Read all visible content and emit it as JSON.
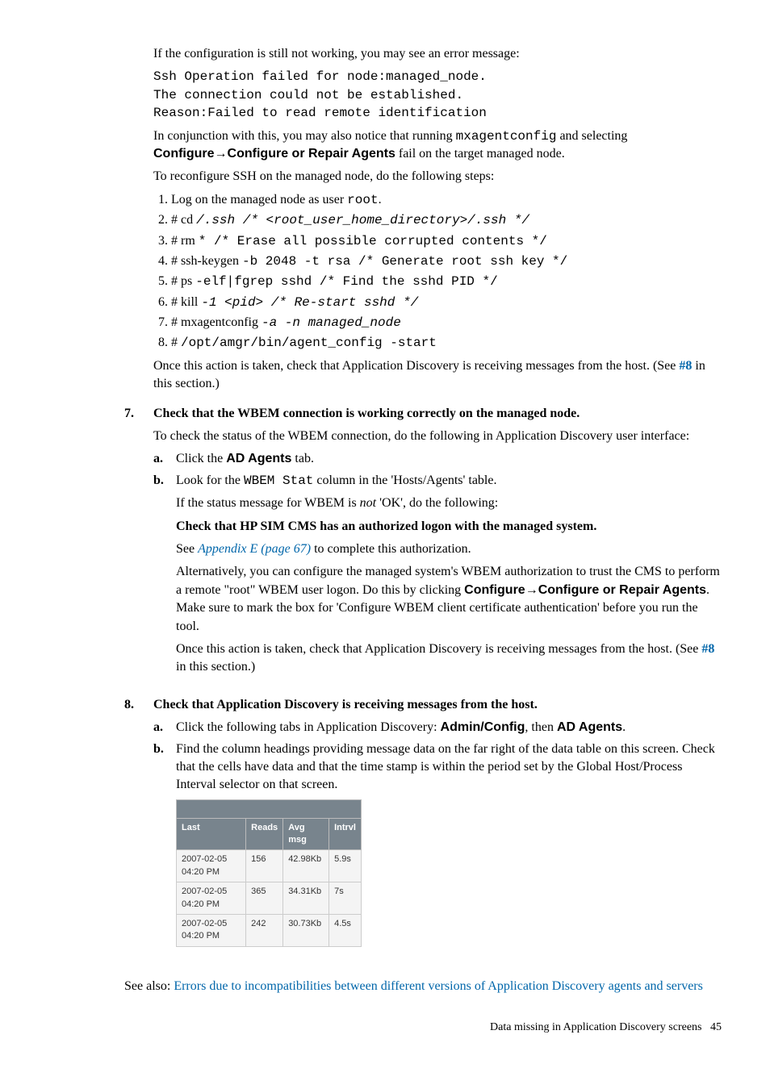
{
  "p1": "If the configuration is still not working, you may see an error message:",
  "err1": "Ssh Operation failed for node:managed_node.",
  "err2": "The connection could not be established.",
  "err3": "Reason:Failed to read remote identification",
  "p2a": "In conjunction with this, you may also notice that running ",
  "p2_code": "mxagentconfig",
  "p2b": " and selecting ",
  "p2_conf": "Configure",
  "arrow": "→",
  "p2_repair": "Configure or Repair Agents",
  "p2c": " fail on the target managed node.",
  "p3": "To reconfigure SSH on the managed node, do the following steps:",
  "li1a": "Log on the managed node as user ",
  "li1_code": "root",
  "li1b": ".",
  "li2a": "# cd ",
  "li2_code": "/.ssh /* <root_user_home_directory>/.ssh */",
  "li3a": "# rm ",
  "li3_code": "* /* Erase all possible corrupted contents */",
  "li4a": "# ssh-keygen ",
  "li4_code": "-b 2048 -t rsa /* Generate root ssh key */",
  "li5a": "# ps ",
  "li5_code": "-elf|fgrep sshd /* Find the sshd PID */",
  "li6a": "# kill ",
  "li6_code": "-1 <pid> /* Re-start sshd */",
  "li7a": "# mxagentconfig ",
  "li7_code": "-a -n managed_node",
  "li8a": "# ",
  "li8_code": "/opt/amgr/bin/agent_config -start",
  "p4a": "Once this action is taken, check that Application Discovery is receiving messages from the host. (See ",
  "p4_link": "#8",
  "p4b": " in this section.)",
  "step7_num": "7.",
  "step7_title": "Check that the WBEM connection is working correctly on the managed node.",
  "step7_p1": "To check the status of the WBEM connection, do the following in Application Discovery user interface:",
  "s7a_letter": "a.",
  "s7a_1": "Click the ",
  "s7a_bold": "AD Agents",
  "s7a_2": " tab.",
  "s7b_letter": "b.",
  "s7b_1": "Look for the ",
  "s7b_code": "WBEM Stat",
  "s7b_2": " column in the 'Hosts/Agents' table.",
  "s7b_p2a": "If the status message for WBEM is ",
  "s7b_not": "not",
  "s7b_p2b": " 'OK', do the following:",
  "s7b_bold_line": "Check that HP SIM CMS has an authorized logon with the managed system.",
  "s7b_see": "See ",
  "s7b_link": "Appendix E (page 67)",
  "s7b_see2": " to complete this authorization.",
  "s7b_alt1": "Alternatively, you can configure the managed system's WBEM authorization to trust the CMS to perform a remote \"root\" WBEM user logon. Do this by clicking ",
  "s7b_conf": "Configure",
  "s7b_repair": "Configure or Repair Agents",
  "s7b_alt2": ". Make sure to mark the box for 'Configure WBEM client certificate authentication' before you run the tool.",
  "s7b_once_a": "Once this action is taken, check that Application Discovery is receiving messages from the host. (See ",
  "s7b_once_link": "#8",
  "s7b_once_b": " in this section.)",
  "step8_num": "8.",
  "step8_title": "Check that Application Discovery is receiving messages from the host.",
  "s8a_letter": "a.",
  "s8a_1": "Click the following tabs in Application Discovery: ",
  "s8a_b1": "Admin/Config",
  "s8a_2": ", then ",
  "s8a_b2": "AD Agents",
  "s8a_3": ".",
  "s8b_letter": "b.",
  "s8b_text": "Find the column headings providing message data on the far right of the data table on this screen. Check that the cells have data and that the time stamp is within the period set by the Global Host/Process Interval selector on that screen.",
  "table": {
    "headers": [
      "Last",
      "Reads",
      "Avg msg",
      "Intrvl"
    ],
    "rows": [
      [
        "2007-02-05 04:20 PM",
        "156",
        "42.98Kb",
        "5.9s"
      ],
      [
        "2007-02-05 04:20 PM",
        "365",
        "34.31Kb",
        "7s"
      ],
      [
        "2007-02-05 04:20 PM",
        "242",
        "30.73Kb",
        "4.5s"
      ]
    ]
  },
  "seealso_a": "See also: ",
  "seealso_link": "Errors due to incompatibilities between different versions of Application Discovery agents and servers",
  "footer_text": "Data missing in Application Discovery screens",
  "footer_page": "45"
}
